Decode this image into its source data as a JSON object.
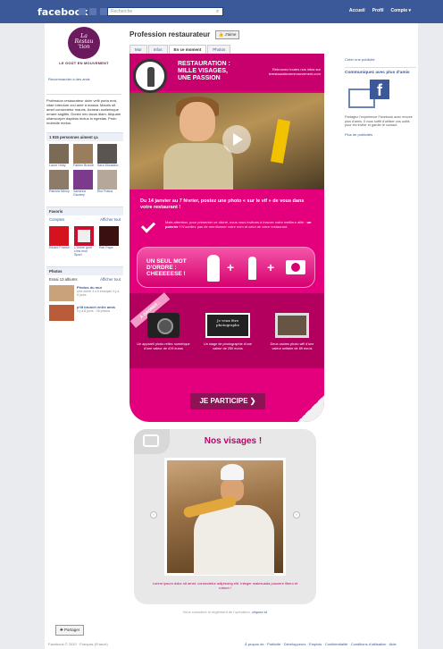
{
  "topbar": {
    "logo": "facebook",
    "search_placeholder": "Recherche",
    "nav": [
      "Accueil",
      "Profil",
      "Compte ▾"
    ]
  },
  "left": {
    "logo_line1": "La",
    "logo_line2": "Restau",
    "logo_line3": "'tion",
    "tagline": "LE GOÛT EN MOUVEMENT",
    "recommend_link": "Recommander à des amis",
    "info_text": "Profession restaurateur dolm velit porta erat, vitae interdum orci ante a massa. Mauris sit amet consectetur mauris. Aenean scelerisque ornare sagittis. Donec nec lacus diam. Aliquam ullamcorper dapibus lectus in egestas. Proin molestie metus.",
    "friends_head": "1 915 personnes aiment ça",
    "friends": [
      "Laure Hoby",
      "Fabien Brandt",
      "Sara Morasino",
      "Patricia Mercy",
      "Sandrine Gautrey",
      "Éloi Fralca"
    ],
    "favorites_head": "Favoris",
    "favorites_sub": "Comptes",
    "favorites_link": "Afficher tout",
    "favorites": [
      "Ricard France",
      "L'Usine goût c'est mon Sport",
      "Riel Pape"
    ],
    "photos_head": "Photos",
    "photos_sub": "Essai 13 albums",
    "photos_link": "Afficher tout",
    "photo_items": [
      {
        "title": "Photos du mur",
        "sub": "Une duree 3 x 6 envoyée il y a 6 jours"
      },
      {
        "title": "p'tit brunch entre amis",
        "sub": "il y a 8 jours · 26 photos"
      }
    ]
  },
  "header": {
    "page_name": "Profession restaurateur",
    "like": "J'aime",
    "tabs": [
      "Mur",
      "Infos",
      "En ce moment",
      "Photos"
    ]
  },
  "canvas": {
    "title1": "RESTAURATION :",
    "title2": "MILLE VISAGES,",
    "title3": "UNE PASSION",
    "follow": "Retrouvez toutes nos infos sur lerestaurationenmouvement.com",
    "intro": "Du 14 janvier au 7 février, postez une photo « sur le vif » de vous dans votre restaurant !",
    "note_a": "Mais attention, pour présenter ce cliché, nous vous invitons à trouver votre meilleur allié :",
    "note_b": "un poivrier !",
    "note_c": "N'oubliez pas de mentionner votre nom et celui de votre restaurant.",
    "formula_text": "UN SEUL MOT D'ORDRE : CHEEEEESE !",
    "ribbon": "À GAGNER :",
    "prizes": [
      "Un appareil photo reflex numérique d'une valeur de 419 euros",
      "Un stage de photographie d'une valeur de 250 euros",
      "Deux cadres photo wifi d'une valeur unitaire de 89 euros"
    ],
    "board_text": "Je veux être photographe",
    "cta": "JE PARTICIPE  ❯"
  },
  "right": {
    "create_ad": "Créer une publicité",
    "ad_title": "Communiquez avec plus d'amis",
    "ad_text": "Partagez l'expérience Facebook avec encore plus d'amis. Il vous suffit d'utiliser vos outils pour les inviter et garder le contact.",
    "more_ads": "Plus de publicités"
  },
  "visages": {
    "title": "Nos visages !",
    "caption": "Lorem ipsum dolor sit amet, consectetur adipiscing elit. Integer malesuada posuere libero et rutrum !"
  },
  "bottom": {
    "reglement": "Vous consultez le règlement de l'opération,",
    "reglement_link": "cliquez ici",
    "share": "✚ Partager",
    "footer_left": "Facebook © 2010 · Français (France)",
    "footer_right": "À propos de · Publicité · Développeurs · Emplois · Confidentialité · Conditions d'utilisation · Aide"
  }
}
